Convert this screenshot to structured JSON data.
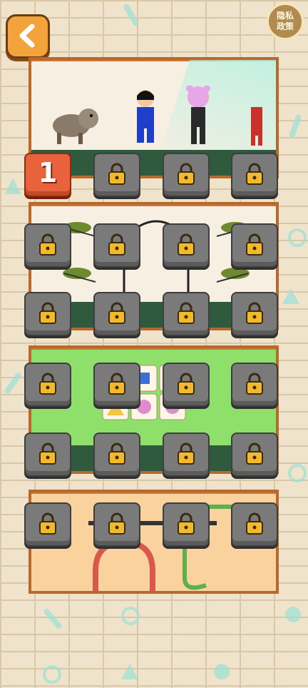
{
  "top_bar": {
    "back_icon": "chevron-left-icon",
    "privacy_label_line1": "隐私",
    "privacy_label_line2": "政策"
  },
  "levels": [
    {
      "label": "1",
      "state": "unlocked"
    },
    {
      "label": "",
      "state": "locked"
    },
    {
      "label": "",
      "state": "locked"
    },
    {
      "label": "",
      "state": "locked"
    },
    {
      "label": "",
      "state": "locked"
    },
    {
      "label": "",
      "state": "locked"
    },
    {
      "label": "",
      "state": "locked"
    },
    {
      "label": "",
      "state": "locked"
    },
    {
      "label": "",
      "state": "locked"
    },
    {
      "label": "",
      "state": "locked"
    },
    {
      "label": "",
      "state": "locked"
    },
    {
      "label": "",
      "state": "locked"
    },
    {
      "label": "",
      "state": "locked"
    },
    {
      "label": "",
      "state": "locked"
    },
    {
      "label": "",
      "state": "locked"
    },
    {
      "label": "",
      "state": "locked"
    },
    {
      "label": "",
      "state": "locked"
    },
    {
      "label": "",
      "state": "locked"
    },
    {
      "label": "",
      "state": "locked"
    },
    {
      "label": "",
      "state": "locked"
    },
    {
      "label": "",
      "state": "locked"
    },
    {
      "label": "",
      "state": "locked"
    },
    {
      "label": "",
      "state": "locked"
    },
    {
      "label": "",
      "state": "locked"
    },
    {
      "label": "",
      "state": "locked"
    },
    {
      "label": "",
      "state": "locked"
    },
    {
      "label": "",
      "state": "locked"
    },
    {
      "label": "",
      "state": "locked"
    }
  ],
  "colors": {
    "unlocked_tile": "#e8633c",
    "locked_tile": "#7a7a7a",
    "frame": "#b86a2d",
    "accent": "#9fe0d4"
  }
}
